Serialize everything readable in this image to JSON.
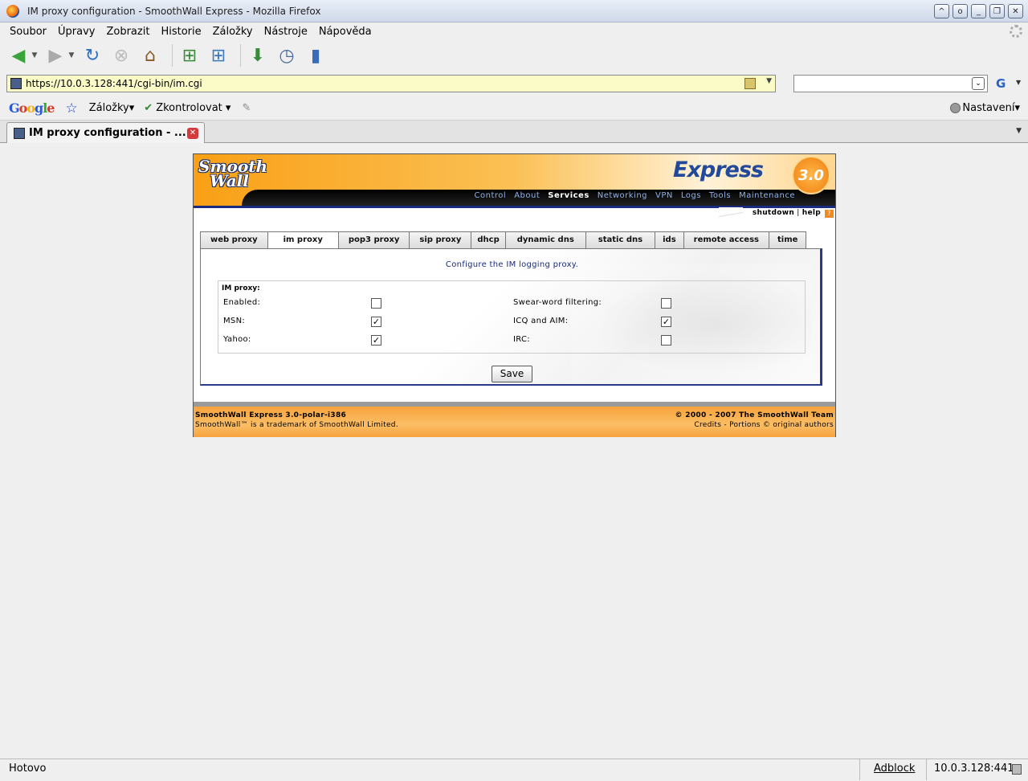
{
  "window": {
    "title": "IM proxy configuration - SmoothWall Express - Mozilla Firefox"
  },
  "menu": [
    "Soubor",
    "Úpravy",
    "Zobrazit",
    "Historie",
    "Záložky",
    "Nástroje",
    "Nápověda"
  ],
  "urlbar": {
    "url": "https://10.0.3.128:441/cgi-bin/im.cgi",
    "search_value": ""
  },
  "googlebar": {
    "logo": "Google",
    "bookmarks": "Záložky",
    "spellcheck": "Zkontrolovat",
    "settings": "Nastavení"
  },
  "tab": {
    "title": "IM proxy configuration - ..."
  },
  "smoothwall": {
    "logo_top": "Smooth",
    "logo_bottom": "Wall",
    "product": "Express",
    "version": "3.0",
    "nav": [
      "Control",
      "About",
      "Services",
      "Networking",
      "VPN",
      "Logs",
      "Tools",
      "Maintenance"
    ],
    "nav_active": "Services",
    "shutdown": "shutdown",
    "sep": "|",
    "help": "help",
    "subtabs": [
      "web proxy",
      "im proxy",
      "pop3 proxy",
      "sip proxy",
      "dhcp",
      "dynamic dns",
      "static dns",
      "ids",
      "remote access",
      "time"
    ],
    "subtab_active": "im proxy",
    "configure_text": "Configure the IM logging proxy.",
    "section_title": "IM proxy:",
    "options": {
      "enabled": {
        "label": "Enabled:",
        "checked": false
      },
      "msn": {
        "label": "MSN:",
        "checked": true
      },
      "yahoo": {
        "label": "Yahoo:",
        "checked": true
      },
      "swear": {
        "label": "Swear-word filtering:",
        "checked": false
      },
      "icq": {
        "label": "ICQ and AIM:",
        "checked": true
      },
      "irc": {
        "label": "IRC:",
        "checked": false
      }
    },
    "save_label": "Save",
    "footer": {
      "left1": "SmoothWall Express 3.0-polar-i386",
      "left2": "SmoothWall™ is a trademark of SmoothWall Limited.",
      "right1": "© 2000 - 2007 The SmoothWall Team",
      "right2": "Credits - Portions © original authors"
    }
  },
  "status": {
    "text": "Hotovo",
    "adblock": "Adblock",
    "host": "10.0.3.128:441"
  },
  "colors": {
    "accent": "#f9a015",
    "nav_blue": "#1a2b80"
  }
}
